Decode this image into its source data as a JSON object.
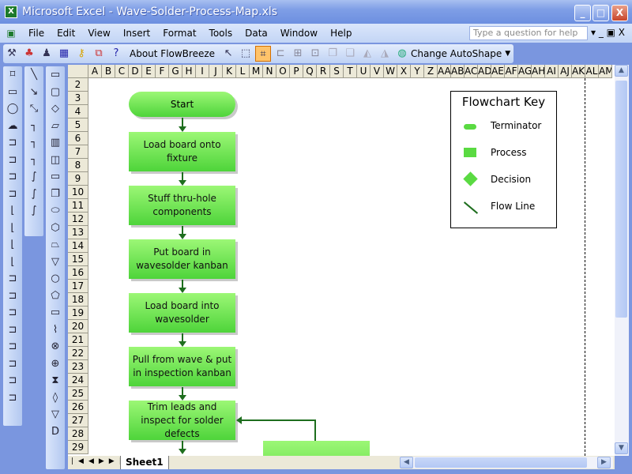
{
  "window": {
    "title": "Microsoft Excel - Wave-Solder-Process-Map.xls",
    "minimize": "_",
    "maximize": "□",
    "close": "X"
  },
  "menu": [
    "File",
    "Edit",
    "View",
    "Insert",
    "Format",
    "Tools",
    "Data",
    "Window",
    "Help"
  ],
  "help_placeholder": "Type a question for help",
  "toolbar": {
    "about": "About FlowBreeze",
    "change_autoshape": "Change AutoShape"
  },
  "columns": [
    "A",
    "B",
    "C",
    "D",
    "E",
    "F",
    "G",
    "H",
    "I",
    "J",
    "K",
    "L",
    "M",
    "N",
    "O",
    "P",
    "Q",
    "R",
    "S",
    "T",
    "U",
    "V",
    "W",
    "X",
    "Y",
    "Z",
    "AA",
    "AB",
    "AC",
    "AD",
    "AE",
    "AF",
    "AG",
    "AH",
    "AI",
    "AJ",
    "AK",
    "AL",
    "AM"
  ],
  "rows": [
    "2",
    "3",
    "4",
    "5",
    "6",
    "7",
    "8",
    "9",
    "10",
    "11",
    "12",
    "13",
    "14",
    "15",
    "16",
    "17",
    "18",
    "19",
    "20",
    "21",
    "22",
    "23",
    "24",
    "25",
    "26",
    "27",
    "28",
    "29"
  ],
  "flow": {
    "start": "Start",
    "steps": [
      "Load board onto fixture",
      "Stuff thru-hole components",
      "Put board in wavesolder kanban",
      "Load board into wavesolder",
      "Pull from wave & put in inspection kanban",
      "Trim leads and inspect for solder defects"
    ]
  },
  "key": {
    "title": "Flowchart Key",
    "items": [
      "Terminator",
      "Process",
      "Decision",
      "Flow Line"
    ]
  },
  "sheet_tab": "Sheet1",
  "colors": {
    "shape_fill": "#6be050",
    "arrow": "#1e6e1e",
    "title_bar": "#7f9ee6"
  }
}
